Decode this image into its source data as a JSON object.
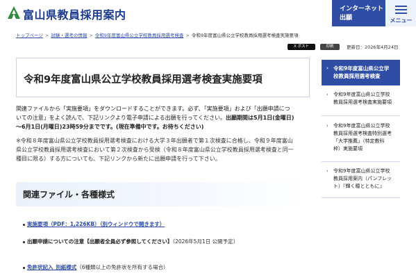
{
  "header": {
    "site_title": "富山県教員採用案内",
    "apply_line1": "インターネット",
    "apply_line2": "出願",
    "menu_label": "メニュー",
    "brand_color": "#2f4da4"
  },
  "breadcrumb": {
    "items": [
      "トップページ",
      "試験・選考の情報",
      "令和9年度富山県公立学校教員採用選考検査"
    ],
    "current": "令和9年度富山県公立学校教員採用選考検査実施要項"
  },
  "share": {
    "x_label": "X ポスト",
    "print_label": "印刷",
    "updated": "更新日：2026年4月24日"
  },
  "main": {
    "title": "令和9年度富山県公立学校教員採用選考検査実施要項",
    "intro_line1": "関連ファイルから「実施要項」をダウンロードすることができます。必ず、「実施要項」および「出願申請につ",
    "intro_line2_a": "いての注意」をよく読んで、下記リンクより電子申請による出願を行ってください。",
    "intro_line2_b": "出願期間は5月1日(金曜日)",
    "intro_line3": "～6月1日(月曜日)23時59分までです。(現在準備中です。お待ちください)",
    "note_line1": "※令和８年度富山県公立学校教員採用選考検査における大学３年出願者で第１次検査に合格し、令和９年度富山",
    "note_line2": "県公立学校教員採用選考検査において第２次検査から受検（令和８年度富山県公立学校教員採用選考検査と同一",
    "note_line3": "種目に限る）する方についても、下記リンクから新たに出願申請を行って下さい。",
    "section_title": "関連ファイル・各種様式",
    "files": [
      {
        "link": "実施要項（PDF：1,226KB）（別ウィンドウで開きます）"
      },
      {
        "bold": "出願申請についての注意【出願者全員必ず参照してください】",
        "extra": "（2026年5月1日 公開予定）"
      },
      {
        "link": "免許状記入_別紙様式",
        "extra": "（6種類以上の免許状を所有する場合）"
      }
    ]
  },
  "sidebar": {
    "head_line1": "令和9年度富山県公立学",
    "head_line2": "校教員採用選考検査",
    "items": [
      {
        "lines": [
          "令和9年度富山県公立学校",
          "教員採用選考検査実施要項"
        ]
      },
      {
        "lines": [
          "令和9年度富山県公立学校",
          "教員採用選考検査特別選考",
          "「大学推薦」（特定教科",
          "枠）実施要項"
        ]
      },
      {
        "lines": [
          "令和9年度富山県公立学校",
          "教員採用案内（パンフレッ",
          "ト）『輝く瞳とともに』"
        ]
      }
    ]
  }
}
